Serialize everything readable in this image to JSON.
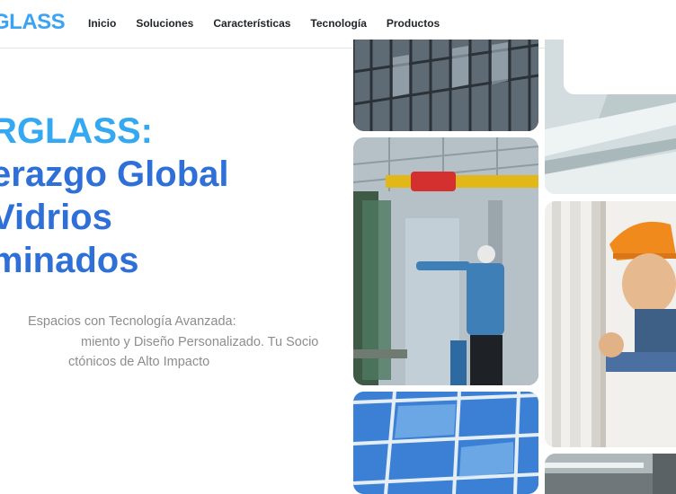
{
  "brand": {
    "logo": "GLASS"
  },
  "nav": {
    "items": [
      {
        "label": "Inicio"
      },
      {
        "label": "Soluciones"
      },
      {
        "label": "Características"
      },
      {
        "label": "Tecnología"
      },
      {
        "label": "Productos"
      }
    ]
  },
  "hero": {
    "title_line1": "RGLASS:",
    "title_line2": "erazgo Global",
    "title_line3": "Vidrios",
    "title_line4": "minados",
    "subtitle_line1": "Espacios con Tecnología Avanzada:",
    "subtitle_line2": "miento y Diseño Personalizado. Tu Socio",
    "subtitle_line3": "ctónicos de Alto Impacto"
  },
  "colors": {
    "logo": "#3aa3f3",
    "title": "#2f6fd8",
    "title_accent": "#35a8f2",
    "subtitle": "#8d8d8d",
    "nav_text": "#1f2328"
  }
}
